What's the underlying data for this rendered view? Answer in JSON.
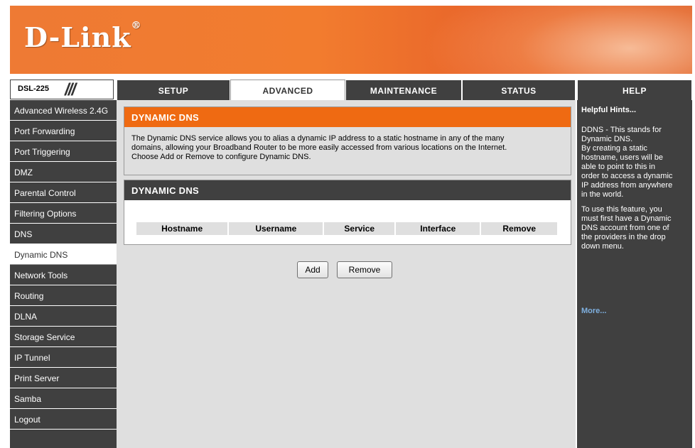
{
  "brand": {
    "logo_text": "D-Link",
    "model": "DSL-225"
  },
  "tabs": [
    {
      "label": "SETUP"
    },
    {
      "label": "ADVANCED"
    },
    {
      "label": "MAINTENANCE"
    },
    {
      "label": "STATUS"
    },
    {
      "label": "HELP"
    }
  ],
  "sidebar": {
    "items": [
      {
        "label": "Advanced Wireless 2.4G"
      },
      {
        "label": "Port Forwarding"
      },
      {
        "label": "Port Triggering"
      },
      {
        "label": "DMZ"
      },
      {
        "label": "Parental Control"
      },
      {
        "label": "Filtering Options"
      },
      {
        "label": "DNS"
      },
      {
        "label": "Dynamic DNS"
      },
      {
        "label": "Network Tools"
      },
      {
        "label": "Routing"
      },
      {
        "label": "DLNA"
      },
      {
        "label": "Storage Service"
      },
      {
        "label": "IP Tunnel"
      },
      {
        "label": "Print Server"
      },
      {
        "label": "Samba"
      },
      {
        "label": "Logout"
      }
    ]
  },
  "main": {
    "section_title": "DYNAMIC DNS",
    "description_lines": [
      "The Dynamic DNS service allows you to alias a dynamic IP address to a static hostname in any of the many",
      "domains, allowing your Broadband Router to be more easily accessed from various locations on the Internet.",
      "Choose Add or Remove to configure Dynamic DNS."
    ],
    "table_title": "DYNAMIC DNS",
    "table_headers": [
      "Hostname",
      "Username",
      "Service",
      "Interface",
      "Remove"
    ],
    "add_label": "Add",
    "remove_label": "Remove"
  },
  "help": {
    "title": "Helpful Hints...",
    "hint_lines": [
      "DDNS - This stands for",
      "Dynamic DNS.",
      "By creating a static",
      "hostname, users will be",
      "able to point to this in",
      "order to access a dynamic",
      "IP address from anywhere",
      "in the world.",
      "",
      "To use this feature, you",
      "must first have a Dynamic",
      "DNS account from one of",
      "the providers in the drop",
      "down menu."
    ],
    "more_label": "More..."
  },
  "colors": {
    "accent": "#ef6a12",
    "dark": "#404040",
    "panel": "#dfdfdf",
    "link": "#7fb0e0"
  }
}
